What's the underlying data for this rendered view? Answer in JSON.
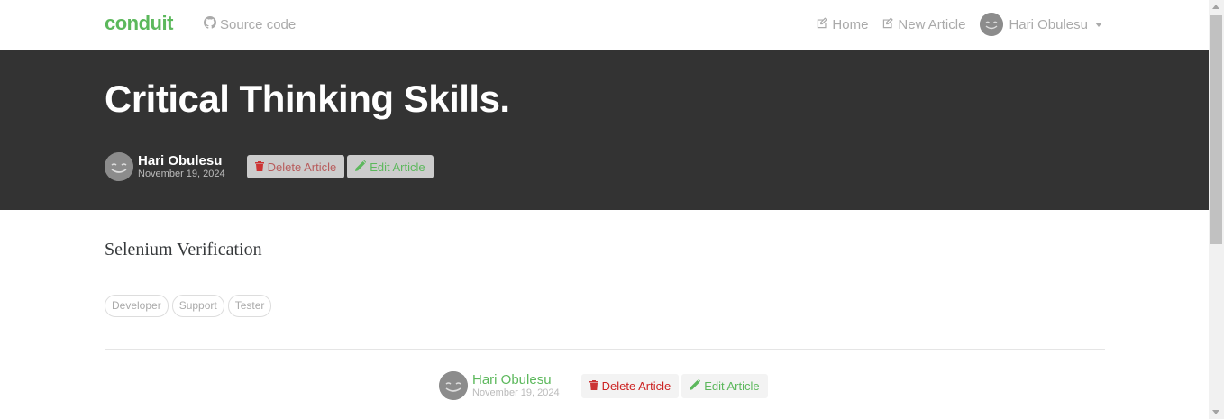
{
  "navbar": {
    "brand": "conduit",
    "source_label": "Source code",
    "links": {
      "home": "Home",
      "new_article": "New Article"
    },
    "user": "Hari Obulesu"
  },
  "article": {
    "title": "Critical Thinking Skills.",
    "author": "Hari Obulesu",
    "date": "November 19, 2024",
    "body": "Selenium Verification",
    "tags": [
      "Developer",
      "Support",
      "Tester"
    ]
  },
  "actions": {
    "delete_label": "Delete Article",
    "edit_label": "Edit Article"
  },
  "colors": {
    "brand": "#5cb85c",
    "banner": "#333333",
    "danger": "#b85c5c"
  },
  "icons": {
    "source": "github-icon",
    "home": "edit-icon",
    "new_article": "edit-icon",
    "delete": "trash-icon",
    "edit": "pencil-icon"
  }
}
